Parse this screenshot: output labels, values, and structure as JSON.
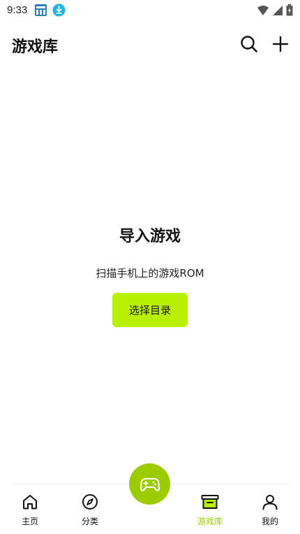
{
  "status_bar": {
    "time": "9:33",
    "icons": [
      "app-notification-icon",
      "download-notification-icon",
      "wifi-icon",
      "signal-icon",
      "battery-icon"
    ]
  },
  "header": {
    "title": "游戏库",
    "actions": [
      "search-icon",
      "plus-icon"
    ]
  },
  "empty_state": {
    "title": "导入游戏",
    "description": "扫描手机上的游戏ROM",
    "button_label": "选择目录"
  },
  "bottom_nav": {
    "items": [
      {
        "label": "主页",
        "icon": "home-icon",
        "active": false
      },
      {
        "label": "分类",
        "icon": "compass-icon",
        "active": false
      },
      {
        "label": "游戏库",
        "icon": "archive-box-icon",
        "active": true
      },
      {
        "label": "我的",
        "icon": "person-icon",
        "active": false
      }
    ],
    "center_button_icon": "gamepad-icon"
  },
  "colors": {
    "accent": "#b8f000",
    "accent_dark": "#9ccc00",
    "text": "#111111"
  }
}
